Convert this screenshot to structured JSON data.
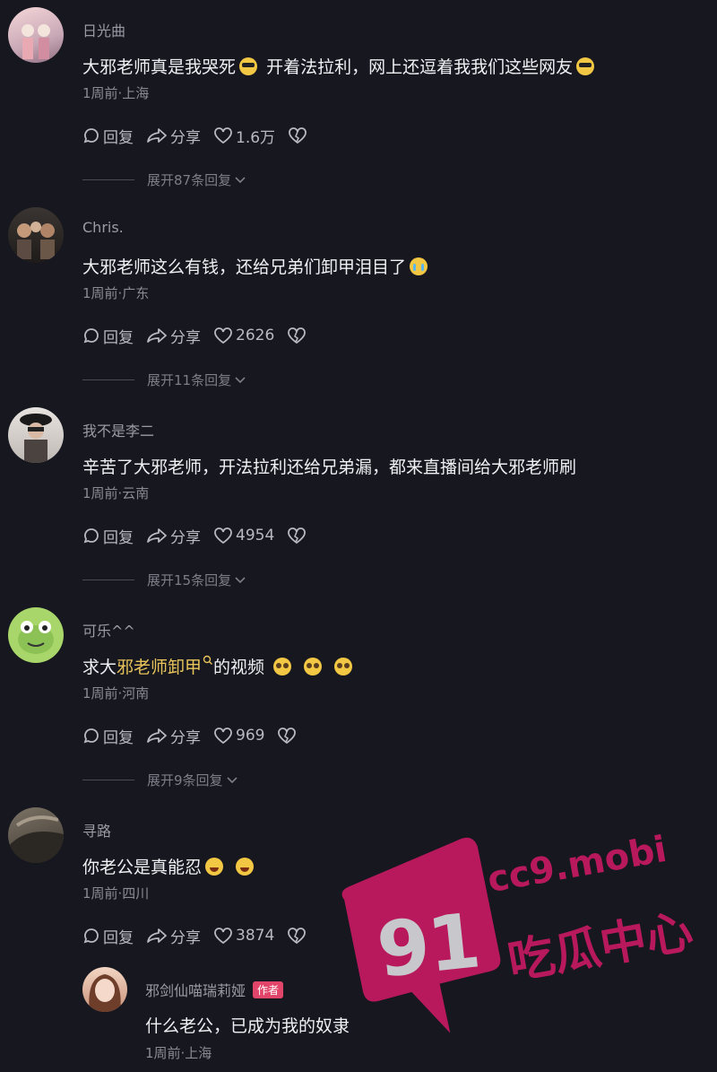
{
  "comments": [
    {
      "username": "日光曲",
      "text_parts": [
        "大邪老师真是我哭死",
        "开着法拉利，网上还逗着我我们这些网友"
      ],
      "meta": "1周前·上海",
      "reply_label": "回复",
      "share_label": "分享",
      "likes": "1.6万",
      "expand": "展开87条回复"
    },
    {
      "username": "Chris.",
      "text_parts": [
        "大邪老师这么有钱，还给兄弟们卸甲泪目了"
      ],
      "meta": "1周前·广东",
      "reply_label": "回复",
      "share_label": "分享",
      "likes": "2626",
      "expand": "展开11条回复"
    },
    {
      "username": "我不是李二",
      "text_parts": [
        "辛苦了大邪老师，开法拉利还给兄弟漏，都来直播间给大邪老师刷"
      ],
      "meta": "1周前·云南",
      "reply_label": "回复",
      "share_label": "分享",
      "likes": "4954",
      "expand": "展开15条回复"
    },
    {
      "username": "可乐^^",
      "text_parts": [
        "求大",
        "邪老师卸甲",
        "的视频"
      ],
      "meta": "1周前·河南",
      "reply_label": "回复",
      "share_label": "分享",
      "likes": "969",
      "expand": "展开9条回复"
    },
    {
      "username": "寻路",
      "text_parts": [
        "你老公是真能忍"
      ],
      "meta": "1周前·四川",
      "reply_label": "回复",
      "share_label": "分享",
      "likes": "3874"
    }
  ],
  "reply": {
    "username": "邪剑仙喵瑞莉娅",
    "badge": "作者",
    "text": "什么老公，已成为我的奴隶",
    "meta": "1周前·上海"
  },
  "watermark": {
    "number": "91",
    "domain": "cc9.mobi",
    "tagline": "吃瓜中心",
    "color": "#b8195c"
  },
  "icons": {
    "reply": "comment-bubble-icon",
    "share": "share-arrow-icon",
    "like": "heart-icon",
    "dislike": "broken-heart-icon",
    "expand": "chevron-down-icon",
    "highlight_search": "search-icon"
  }
}
